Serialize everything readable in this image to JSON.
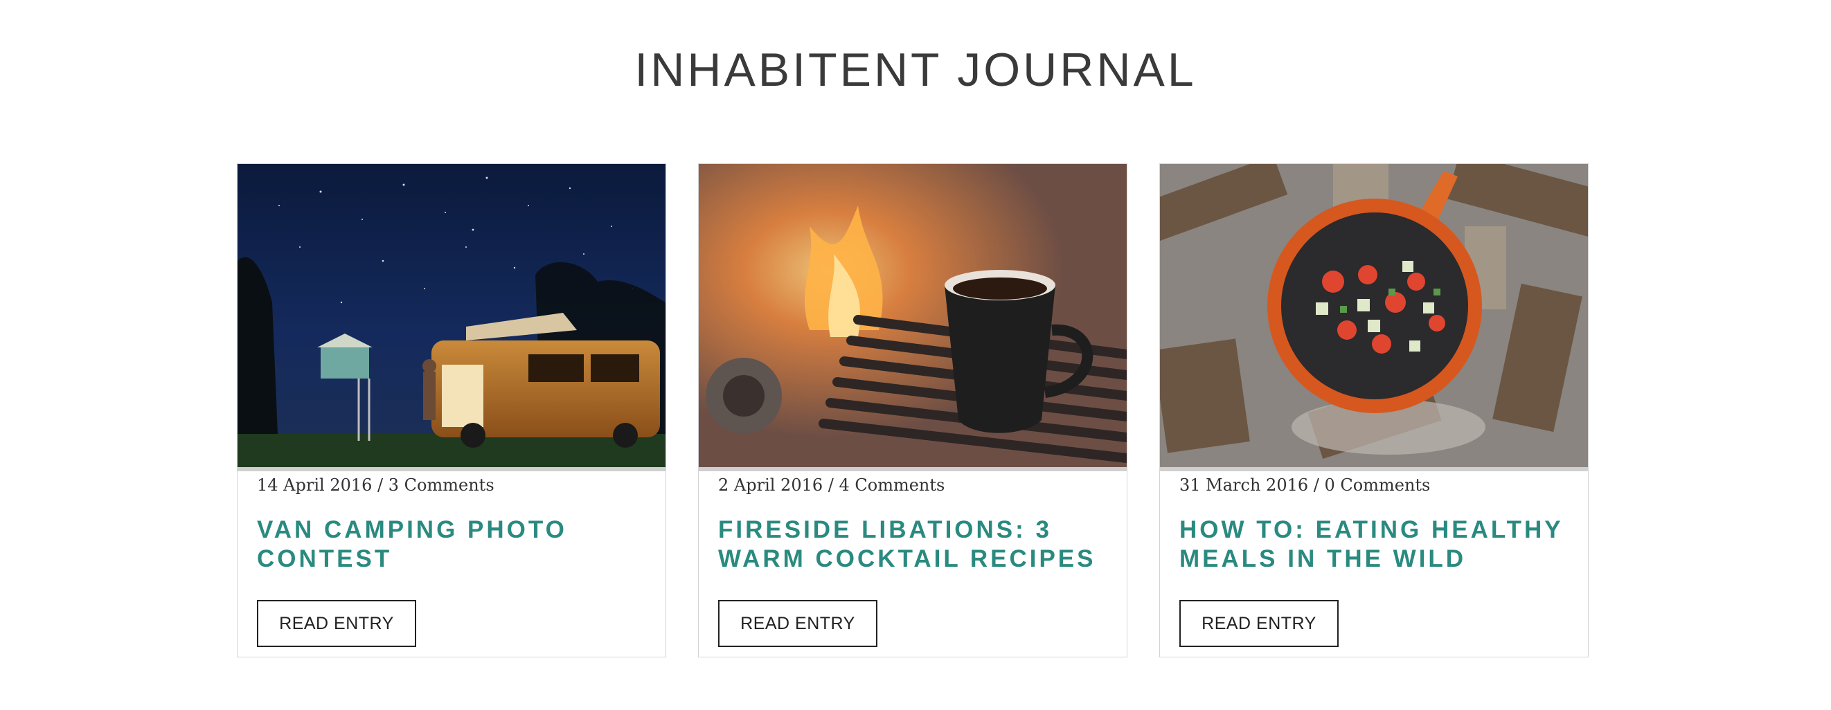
{
  "journal": {
    "title": "INHABITENT JOURNAL"
  },
  "posts": [
    {
      "date": "14 April 2016",
      "separator": "/",
      "comments": "3 Comments",
      "title": "VAN CAMPING PHOTO CONTEST",
      "button_label": "READ ENTRY"
    },
    {
      "date": "2 April 2016",
      "separator": "/",
      "comments": "4 Comments",
      "title": "FIRESIDE LIBATIONS: 3 WARM COCKTAIL RECIPES",
      "button_label": "READ ENTRY"
    },
    {
      "date": "31 March 2016",
      "separator": "/",
      "comments": "0 Comments",
      "title": "HOW TO: EATING HEALTHY MEALS IN THE WILD",
      "button_label": "READ ENTRY"
    }
  ],
  "colors": {
    "accent": "#2a8a80",
    "text": "#333333",
    "border": "#d4d4d4"
  }
}
